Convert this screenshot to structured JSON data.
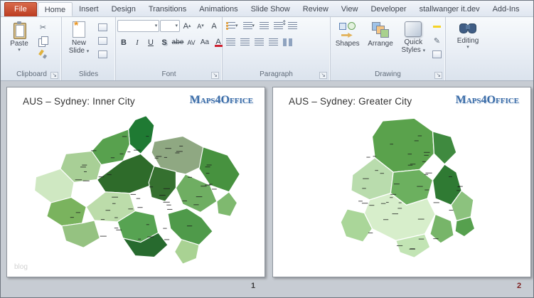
{
  "ribbon": {
    "file_tab": "File",
    "active_tab": "Home",
    "tabs": [
      "Home",
      "Insert",
      "Design",
      "Transitions",
      "Animations",
      "Slide Show",
      "Review",
      "View",
      "Developer",
      "stallwanger it.dev",
      "Add-Ins"
    ],
    "groups": {
      "clipboard": {
        "label": "Clipboard",
        "paste": "Paste"
      },
      "slides": {
        "label": "Slides",
        "new_slide_line1": "New",
        "new_slide_line2": "Slide"
      },
      "font": {
        "label": "Font",
        "bold": "B",
        "italic": "I",
        "underline": "U",
        "shadow": "S",
        "strike": "abe",
        "spacing": "AV",
        "case": "Aa",
        "highlight": "ab",
        "color": "A",
        "grow": "A",
        "shrink": "A",
        "clear": "A"
      },
      "paragraph": {
        "label": "Paragraph"
      },
      "drawing": {
        "label": "Drawing",
        "shapes": "Shapes",
        "arrange": "Arrange",
        "quick_styles_line1": "Quick",
        "quick_styles_line2": "Styles"
      },
      "editing": {
        "label": "Editing"
      }
    }
  },
  "icons": {
    "dropdown": "▾",
    "launcher": "↘",
    "grow_arrow": "▴",
    "shrink_arrow": "▾",
    "updown": "↕",
    "scissors": "✂",
    "pencil": "✎"
  },
  "slides": [
    {
      "title": "AUS – Sydney: Inner City",
      "logo": "Maps4Office",
      "watermark": "blog",
      "page_number": "1"
    },
    {
      "title": "AUS – Sydney: Greater City",
      "logo": "Maps4Office",
      "page_number": "2"
    }
  ]
}
